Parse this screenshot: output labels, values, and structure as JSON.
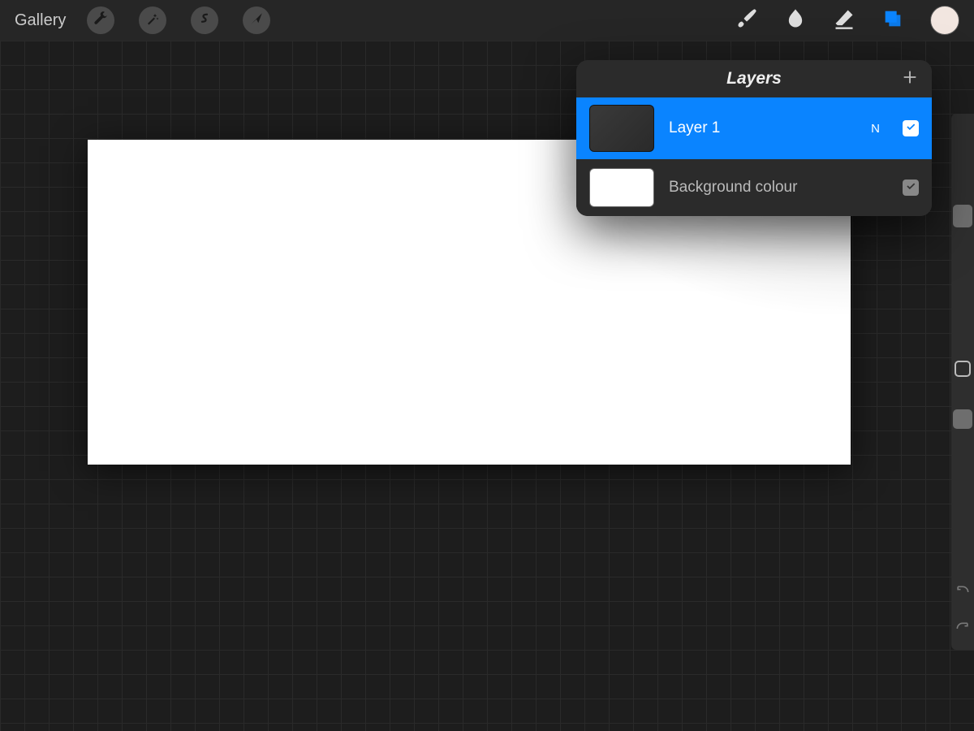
{
  "toolbar": {
    "gallery_label": "Gallery"
  },
  "layers_panel": {
    "title": "Layers",
    "rows": [
      {
        "name": "Layer 1",
        "blend": "N"
      },
      {
        "name": "Background colour"
      }
    ]
  }
}
